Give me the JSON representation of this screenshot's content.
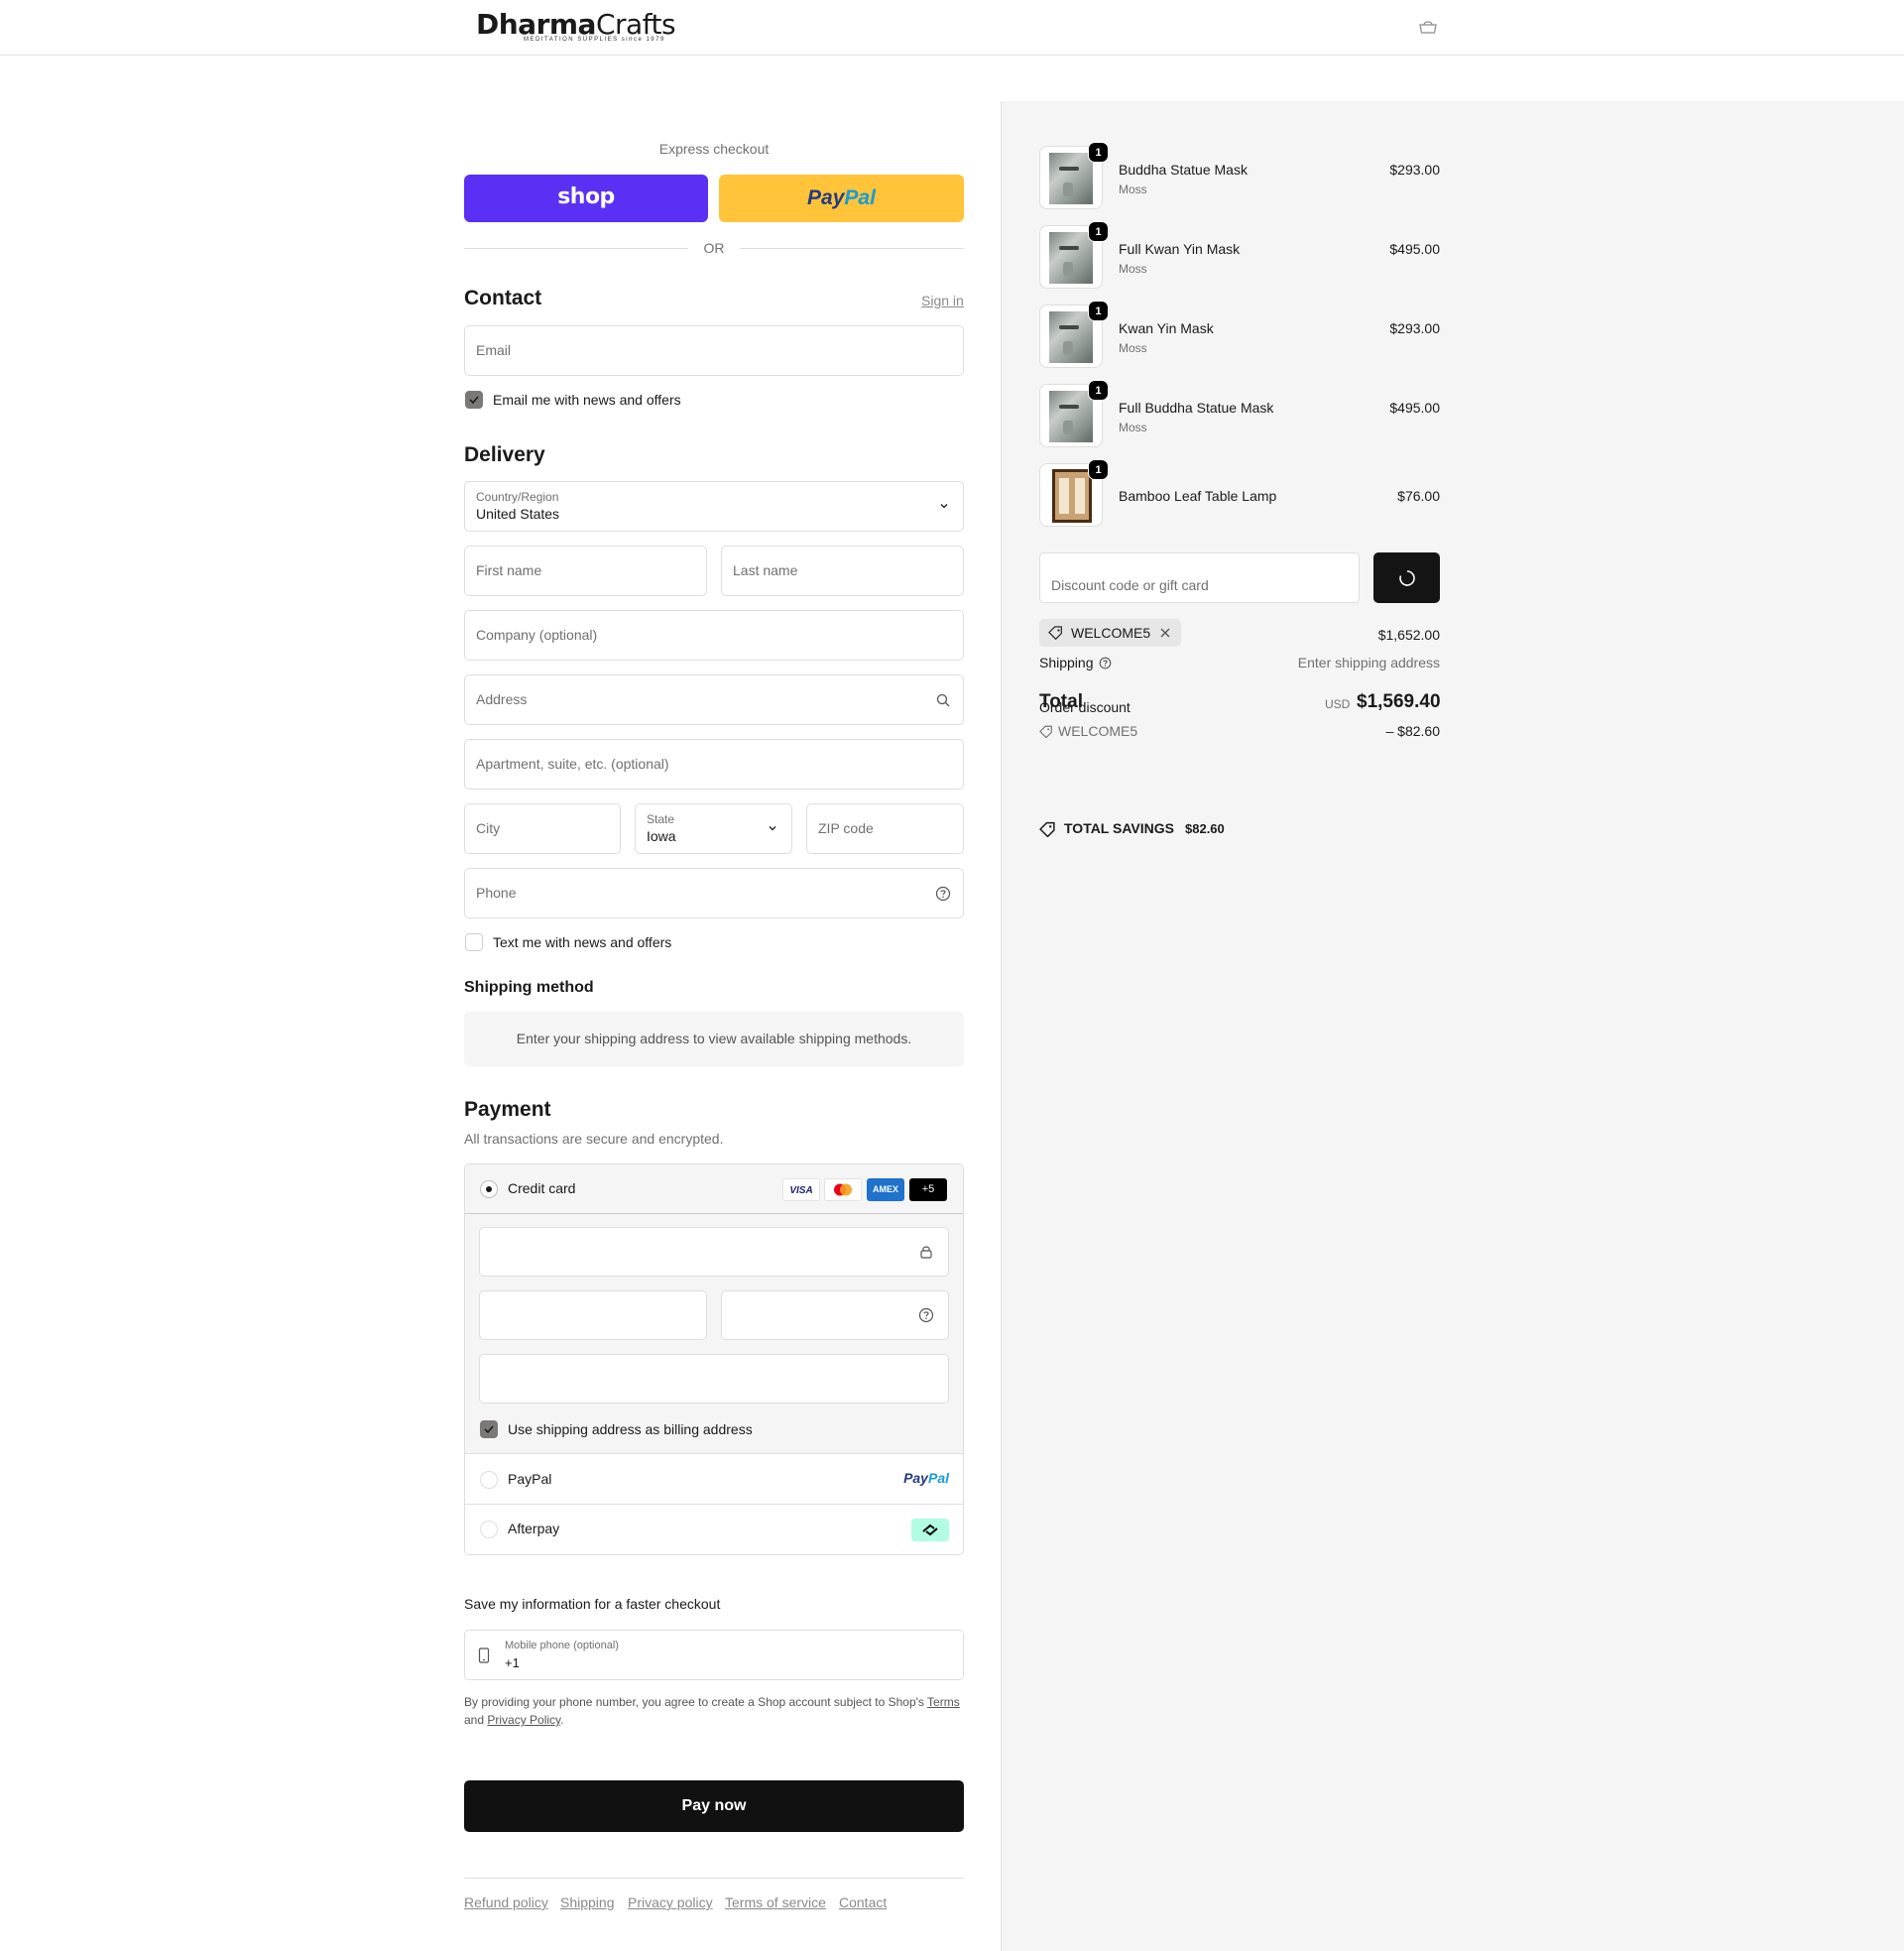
{
  "brand": {
    "logo_main": "Dharma",
    "logo_main_2": "Crafts",
    "logo_tagline": "MEDITATION SUPPLIES since 1979"
  },
  "express": {
    "label": "Express checkout",
    "shop_label": "shop",
    "paypal_a": "Pay",
    "paypal_b": "Pal",
    "or": "OR"
  },
  "contact": {
    "title": "Contact",
    "sign_in": "Sign in",
    "email_placeholder": "Email",
    "news_label": "Email me with news and offers"
  },
  "delivery": {
    "title": "Delivery",
    "country_label": "Country/Region",
    "country_value": "United States",
    "first_name": "First name",
    "last_name": "Last name",
    "company": "Company (optional)",
    "address": "Address",
    "apartment": "Apartment, suite, etc. (optional)",
    "city": "City",
    "state_label": "State",
    "state_value": "Iowa",
    "zip": "ZIP code",
    "phone": "Phone",
    "text_label": "Text me with news and offers"
  },
  "shipping_method": {
    "title": "Shipping method",
    "note": "Enter your shipping address to view available shipping methods."
  },
  "payment": {
    "title": "Payment",
    "subtitle": "All transactions are secure and encrypted.",
    "credit_card": "Credit card",
    "cards": [
      "VISA",
      "",
      "AMEX",
      "+5"
    ],
    "billing_label": "Use shipping address as billing address",
    "paypal_label": "PayPal",
    "paypal_logo_a": "Pay",
    "paypal_logo_b": "Pal",
    "afterpay_label": "Afterpay"
  },
  "save_info": {
    "title": "Save my information for a faster checkout",
    "mobile_label": "Mobile phone (optional)",
    "mobile_value": "+1",
    "legal_1": "By providing your phone number, you agree to create a Shop account subject to Shop's",
    "legal_terms": "Terms",
    "legal_and": "and",
    "legal_privacy": "Privacy Policy",
    "legal_end": "."
  },
  "pay_now": "Pay now",
  "footer_links": [
    "Refund policy",
    "Shipping",
    "Privacy policy",
    "Terms of service",
    "Contact"
  ],
  "cart": {
    "items": [
      {
        "name": "Buddha Statue Mask",
        "variant": "Moss",
        "price": "$293.00",
        "qty": "1"
      },
      {
        "name": "Full Kwan Yin Mask",
        "variant": "Moss",
        "price": "$495.00",
        "qty": "1"
      },
      {
        "name": "Kwan Yin Mask",
        "variant": "Moss",
        "price": "$293.00",
        "qty": "1"
      },
      {
        "name": "Full Buddha Statue Mask",
        "variant": "Moss",
        "price": "$495.00",
        "qty": "1"
      },
      {
        "name": "Bamboo Leaf Table Lamp",
        "variant": "",
        "price": "$76.00",
        "qty": "1"
      }
    ],
    "discount_placeholder": "Discount code or gift card",
    "applied_code": "WELCOME5",
    "subtotal": "$1,652.00",
    "shipping_label": "Shipping",
    "shipping_value": "Enter shipping address",
    "total_label": "Total",
    "currency": "USD",
    "total": "$1,569.40",
    "order_discount_label": "Order discount",
    "discount_code": "WELCOME5",
    "discount_value": "– $82.60",
    "savings_label": "TOTAL SAVINGS",
    "savings_value": "$82.60"
  }
}
